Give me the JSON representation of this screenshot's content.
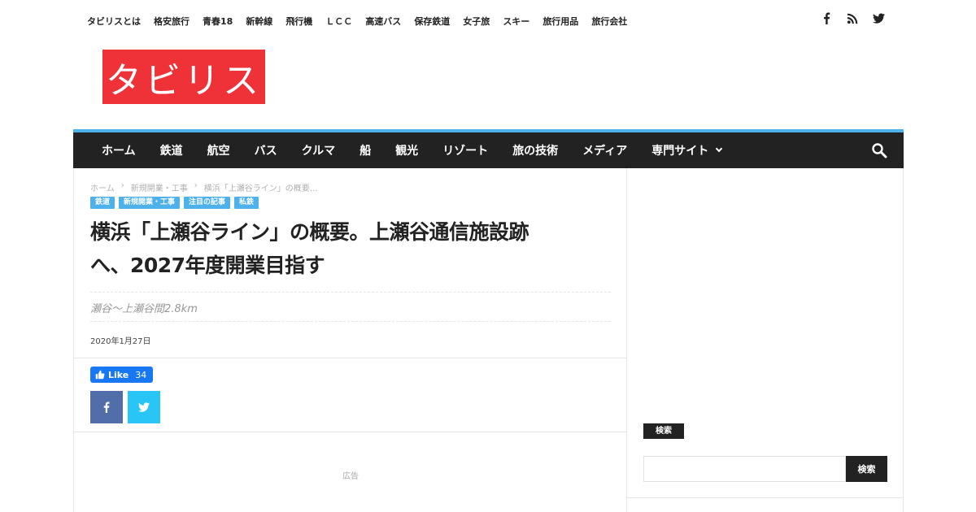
{
  "top_nav": {
    "items": [
      "タビリスとは",
      "格安旅行",
      "青春18",
      "新幹線",
      "飛行機",
      "ＬＣＣ",
      "高速バス",
      "保存鉄道",
      "女子旅",
      "スキー",
      "旅行用品",
      "旅行会社"
    ]
  },
  "social": {
    "icons": [
      "facebook-icon",
      "rss-icon",
      "twitter-icon"
    ]
  },
  "logo": {
    "text": "タビリス",
    "color": "#ee3237"
  },
  "main_nav": {
    "items": [
      "ホーム",
      "鉄道",
      "航空",
      "バス",
      "クルマ",
      "船",
      "観光",
      "リゾート",
      "旅の技術",
      "メディア",
      "専門サイト"
    ],
    "accent": "#4db2ec",
    "background": "#222222"
  },
  "article": {
    "breadcrumb": [
      "ホーム",
      "新規開業・工事",
      "横浜「上瀬谷ライン」の概要…"
    ],
    "tags": [
      "鉄道",
      "新規開業・工事",
      "注目の記事",
      "私鉄"
    ],
    "title_line1": "横浜「上瀬谷ライン」の概要。上瀬谷通信施設跡",
    "title_line2": "へ、2027年度開業目指す",
    "subtitle": "瀬谷～上瀬谷間2.8km",
    "date": "2020年1月27日",
    "like_label": "Like",
    "like_count": "34",
    "ad_label": "広告"
  },
  "sidebar": {
    "heading": "検索",
    "search_placeholder": "",
    "search_button": "検索"
  }
}
